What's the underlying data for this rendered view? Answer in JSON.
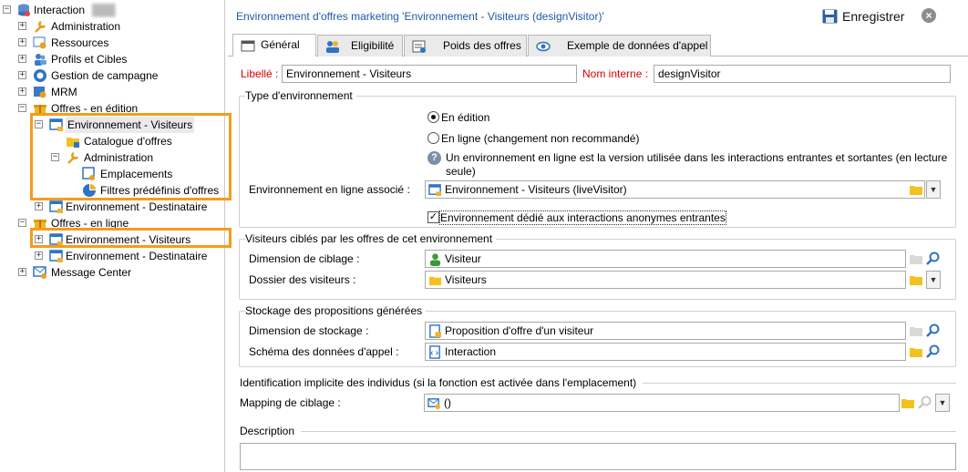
{
  "tree": {
    "root_label": "Interaction",
    "root_blurred_suffix": "███",
    "items": {
      "administration": "Administration",
      "ressources": "Ressources",
      "profils": "Profils et Cibles",
      "campagne": "Gestion de campagne",
      "mrm": "MRM",
      "offres_edition": "Offres - en édition",
      "env_visiteurs_edit": "Environnement - Visiteurs",
      "catalogue": "Catalogue d'offres",
      "admin_sub": "Administration",
      "emplacements": "Emplacements",
      "filtres": "Filtres prédéfinis d'offres",
      "env_destinataire_edit": "Environnement - Destinataire",
      "offres_ligne": "Offres - en ligne",
      "env_visiteurs_ligne": "Environnement - Visiteurs",
      "env_destinataire_ligne": "Environnement - Destinataire",
      "message_center": "Message Center"
    }
  },
  "header": {
    "title": "Environnement d'offres marketing 'Environnement - Visiteurs (designVisitor)'",
    "save_label": "Enregistrer"
  },
  "tabs": [
    "Général",
    "Eligibilité",
    "Poids des offres",
    "Exemple de données d'appel"
  ],
  "form": {
    "libelle_label": "Libellé :",
    "libelle_value": "Environnement - Visiteurs",
    "nom_interne_label": "Nom interne :",
    "nom_interne_value": "designVisitor",
    "type_section": "Type d'environnement",
    "radio_edition": "En édition",
    "radio_ligne": "En ligne (changement non recommandé)",
    "info_text_1": "Un environnement en ligne est la version utilisée dans les interactions entrantes et sortantes (en lecture",
    "info_text_2": "seule)",
    "env_associe_label": "Environnement en ligne associé :",
    "env_associe_value": "Environnement - Visiteurs (liveVisitor)",
    "checkbox_anonymes": "Environnement dédié aux interactions anonymes entrantes",
    "visiteurs_section": "Visiteurs ciblés par les offres de cet environnement",
    "dimension_ciblage_label": "Dimension de ciblage :",
    "dimension_ciblage_value": "Visiteur",
    "dossier_visiteurs_label": "Dossier des visiteurs :",
    "dossier_visiteurs_value": "Visiteurs",
    "stockage_section": "Stockage des propositions générées",
    "dimension_stockage_label": "Dimension de stockage :",
    "dimension_stockage_value": "Proposition d'offre d'un visiteur",
    "schema_appel_label": "Schéma des données d'appel :",
    "schema_appel_value": "Interaction",
    "identification_section": "Identification implicite des individus (si la fonction est activée dans l'emplacement)",
    "mapping_label": "Mapping de ciblage :",
    "mapping_value": "()",
    "description_label": "Description"
  },
  "colors": {
    "title_blue": "#1e5aa8",
    "highlight_orange": "#f39c1c",
    "required_red": "#dd0000",
    "folder_yellow": "#f4c21f"
  }
}
